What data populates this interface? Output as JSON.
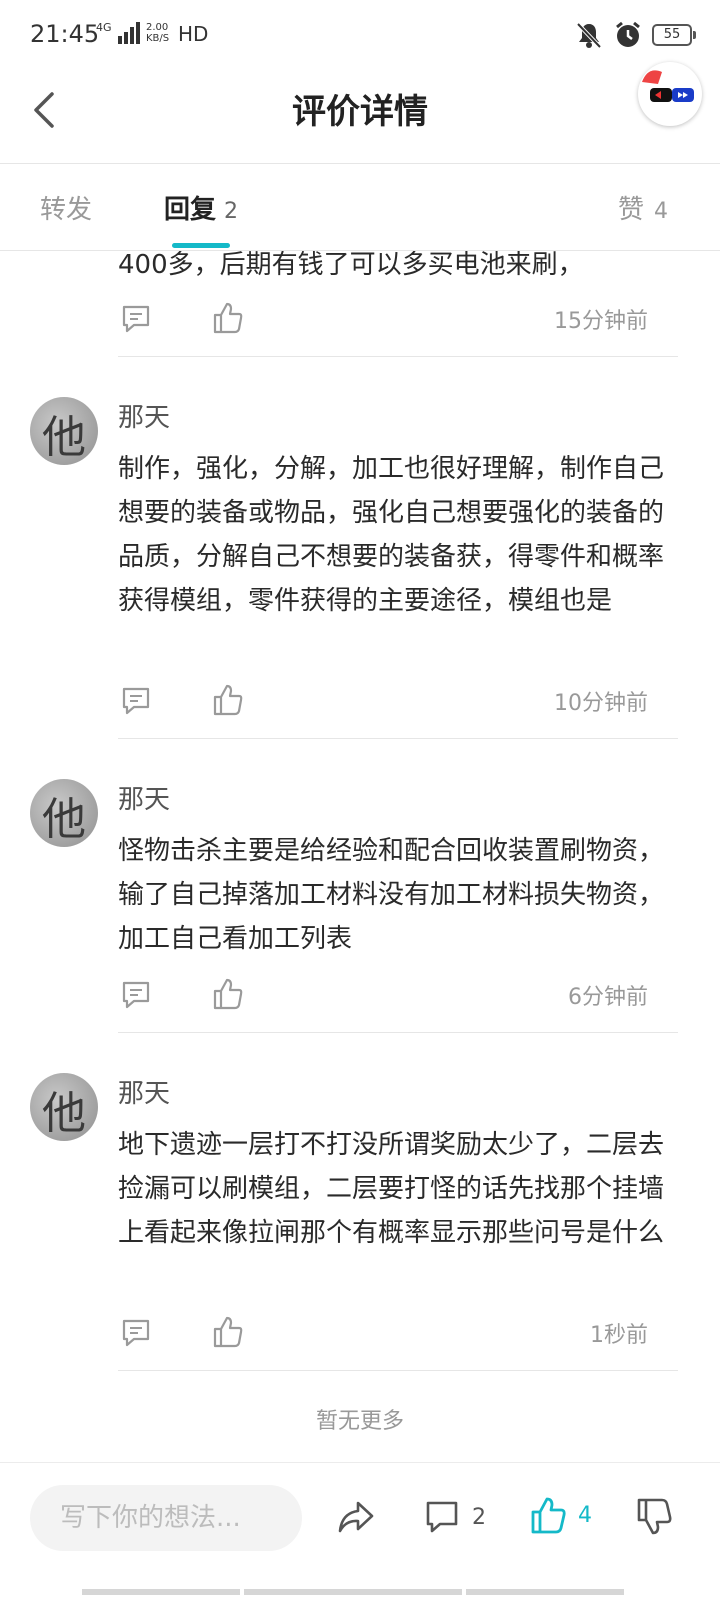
{
  "status": {
    "time": "21:45",
    "network": "4G",
    "speed_top": "2.00",
    "speed_bottom": "KB/S",
    "hd": "HD",
    "battery": "55"
  },
  "header": {
    "title": "评价详情"
  },
  "tabs": {
    "forward_label": "转发",
    "reply_label": "回复",
    "reply_count": "2",
    "like_label": "赞",
    "like_count": "4"
  },
  "replies": [
    {
      "text": "400多，后期有钱了可以多买电池来刷，",
      "time": "15分钟前"
    },
    {
      "author": "那天",
      "avatar_char": "他",
      "text": "制作，强化，分解，加工也很好理解，制作自己想要的装备或物品，强化自己想要强化的装备的品质，分解自己不想要的装备获，得零件和概率获得模组，零件获得的主要途径，模组也是",
      "time": "10分钟前"
    },
    {
      "author": "那天",
      "avatar_char": "他",
      "text": "怪物击杀主要是给经验和配合回收装置刷物资，输了自己掉落加工材料没有加工材料损失物资，加工自己看加工列表",
      "time": "6分钟前"
    },
    {
      "author": "那天",
      "avatar_char": "他",
      "text": "地下遗迹一层打不打没所谓奖励太少了，二层去捡漏可以刷模组，二层要打怪的话先找那个挂墙上看起来像拉闸那个有概率显示那些问号是什么",
      "time": "1秒前"
    }
  ],
  "footer_note": "暂无更多",
  "bottom_bar": {
    "input_placeholder": "写下你的想法...",
    "comment_count": "2",
    "like_count": "4"
  },
  "colors": {
    "accent": "#14b9c8",
    "text_primary": "#222222",
    "text_muted": "#999999"
  }
}
